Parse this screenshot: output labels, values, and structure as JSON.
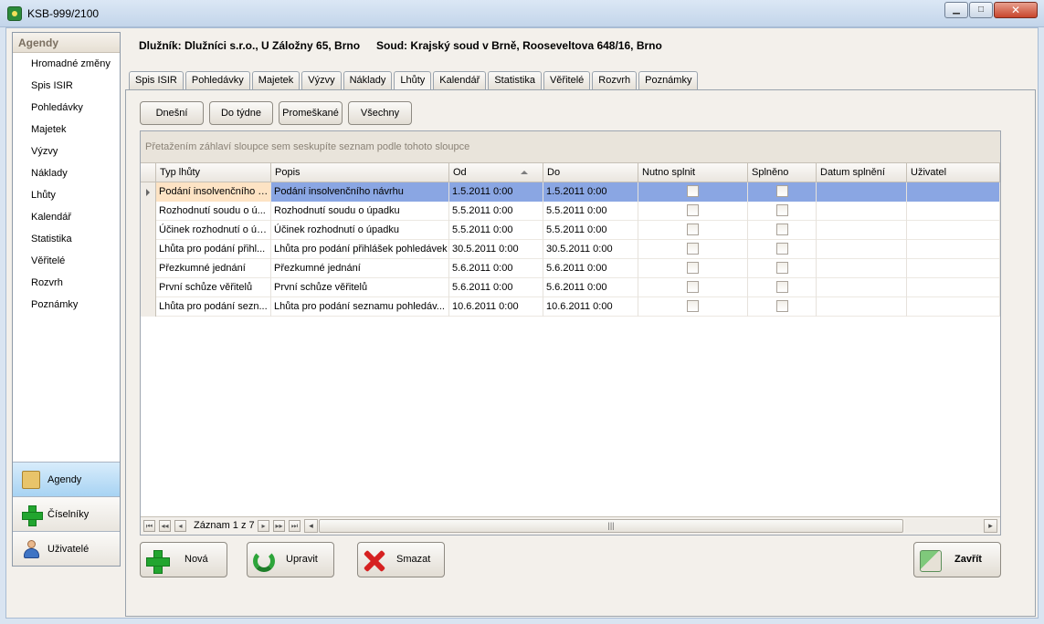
{
  "window": {
    "title": "KSB-999/2100"
  },
  "nav": {
    "header": "Agendy",
    "items": [
      "Hromadné změny",
      "Spis ISIR",
      "Pohledávky",
      "Majetek",
      "Výzvy",
      "Náklady",
      "Lhůty",
      "Kalendář",
      "Statistika",
      "Věřitelé",
      "Rozvrh",
      "Poznámky"
    ],
    "groups": [
      {
        "label": "Agendy",
        "icon": "folder-icon",
        "active": true
      },
      {
        "label": "Číselníky",
        "icon": "green-plus-icon",
        "active": false
      },
      {
        "label": "Uživatelé",
        "icon": "user-icon",
        "active": false
      }
    ]
  },
  "header": {
    "debtor": "Dlužník: Dlužníci s.r.o., U Záložny 65, Brno",
    "court": "Soud: Krajský soud v Brně, Rooseveltova 648/16, Brno"
  },
  "tabs": [
    "Spis ISIR",
    "Pohledávky",
    "Majetek",
    "Výzvy",
    "Náklady",
    "Lhůty",
    "Kalendář",
    "Statistika",
    "Věřitelé",
    "Rozvrh",
    "Poznámky"
  ],
  "active_tab": "Lhůty",
  "filters": [
    "Dnešní",
    "Do týdne",
    "Promeškané",
    "Všechny"
  ],
  "grid": {
    "group_hint": "Přetažením záhlaví sloupce sem seskupíte seznam podle tohoto sloupce",
    "columns": [
      "Typ lhůty",
      "Popis",
      "Od",
      "Do",
      "Nutno splnit",
      "Splněno",
      "Datum splnění",
      "Uživatel"
    ],
    "rows": [
      {
        "typ": "Podání insolvenčního n...",
        "popis": "Podání insolvenčního návrhu",
        "od": "1.5.2011 0:00",
        "do": "1.5.2011 0:00",
        "datum": "",
        "uzivatel": ""
      },
      {
        "typ": "Rozhodnutí soudu o ú...",
        "popis": "Rozhodnutí soudu o úpadku",
        "od": "5.5.2011 0:00",
        "do": "5.5.2011 0:00",
        "datum": "",
        "uzivatel": ""
      },
      {
        "typ": "Účinek rozhodnutí o úp...",
        "popis": "Účinek rozhodnutí o úpadku",
        "od": "5.5.2011 0:00",
        "do": "5.5.2011 0:00",
        "datum": "",
        "uzivatel": ""
      },
      {
        "typ": "Lhůta pro podání přihl...",
        "popis": "Lhůta pro podání přihlášek pohledávek",
        "od": "30.5.2011 0:00",
        "do": "30.5.2011 0:00",
        "datum": "",
        "uzivatel": ""
      },
      {
        "typ": "Přezkumné jednání",
        "popis": "Přezkumné jednání",
        "od": "5.6.2011 0:00",
        "do": "5.6.2011 0:00",
        "datum": "",
        "uzivatel": ""
      },
      {
        "typ": "První schůze věřitelů",
        "popis": "První schůze věřitelů",
        "od": "5.6.2011 0:00",
        "do": "5.6.2011 0:00",
        "datum": "",
        "uzivatel": ""
      },
      {
        "typ": "Lhůta pro podání sezn...",
        "popis": "Lhůta pro podání seznamu pohledáv...",
        "od": "10.6.2011 0:00",
        "do": "10.6.2011 0:00",
        "datum": "",
        "uzivatel": ""
      }
    ],
    "navigator_text": "Záznam 1 z 7"
  },
  "actions": {
    "new": "Nová",
    "edit": "Upravit",
    "delete": "Smazat",
    "close": "Zavřít"
  }
}
